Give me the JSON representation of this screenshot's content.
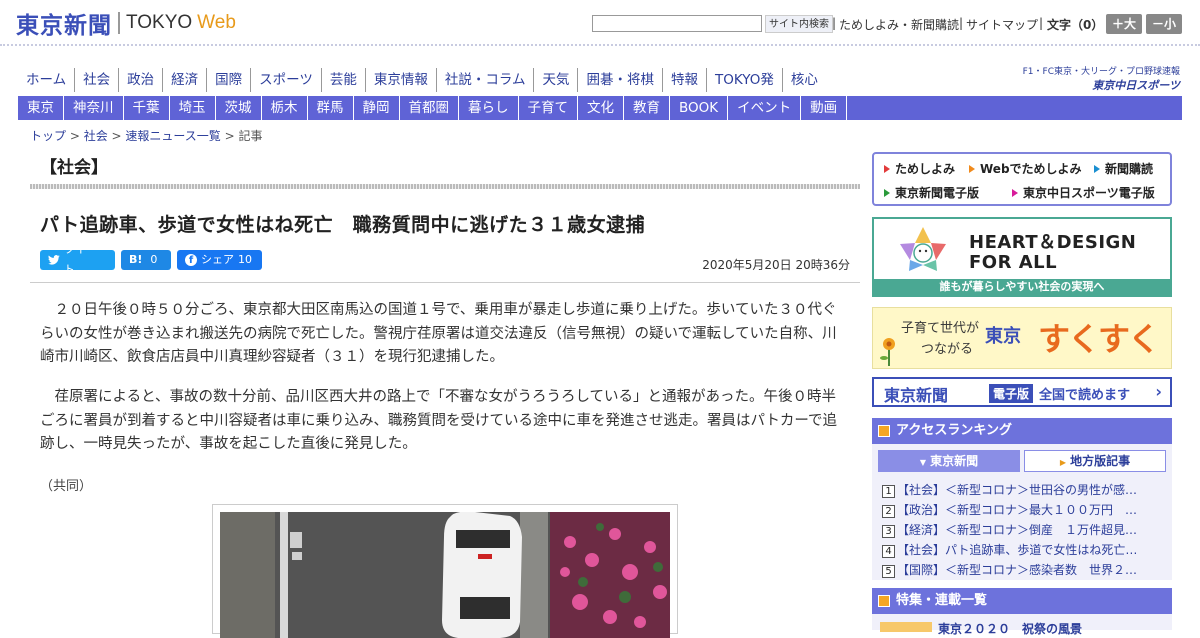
{
  "header": {
    "logo_jp": "東京新聞",
    "logo_en": "TOKYO",
    "logo_web": "Web",
    "search_placeholder": "",
    "search_button": "サイト内検索",
    "link_trial": "ためしよみ・新聞購読",
    "link_sitemap": "サイトマップ",
    "font_size_label": "文字（0）",
    "font_larger": "＋大",
    "font_smaller": "－小"
  },
  "main_nav": [
    "ホーム",
    "社会",
    "政治",
    "経済",
    "国際",
    "スポーツ",
    "芸能",
    "東京情報",
    "社説・コラム",
    "天気",
    "囲碁・将棋",
    "特報",
    "TOKYO発",
    "核心"
  ],
  "sponsor": {
    "line1": "F1・FC東京・大リーグ・プロ野球速報",
    "line2": "東京中日スポーツ"
  },
  "region_nav": [
    "東京",
    "神奈川",
    "千葉",
    "埼玉",
    "茨城",
    "栃木",
    "群馬",
    "静岡",
    "首都圏",
    "暮らし",
    "子育て",
    "文化",
    "教育",
    "BOOK",
    "イベント",
    "動画"
  ],
  "breadcrumb": {
    "top": "トップ",
    "sep": " > ",
    "social": "社会",
    "news": "速報ニュース一覧",
    "current": "記事"
  },
  "article": {
    "section": "【社会】",
    "headline": "パト追跡車、歩道で女性はね死亡　職務質問中に逃げた３１歳女逮捕",
    "tweet_label": "ツイート",
    "hatena_label": "B!",
    "hatena_count": "0",
    "fb_label": "シェア",
    "fb_count": "10",
    "date": "2020年5月20日 20時36分",
    "paragraphs": [
      "２０日午後０時５０分ごろ、東京都大田区南馬込の国道１号で、乗用車が暴走し歩道に乗り上げた。歩いていた３０代ぐらいの女性が巻き込まれ搬送先の病院で死亡した。警視庁荏原署は道交法違反（信号無視）の疑いで運転していた自称、川崎市川崎区、飲食店店員中川真理紗容疑者（３１）を現行犯逮捕した。",
      "荏原署によると、事故の数十分前、品川区西大井の路上で「不審な女がうろうろしている」と通報があった。午後０時半ごろに署員が到着すると中川容疑者は車に乗り込み、職務質問を受けている途中に車を発進させ逃走。署員はパトカーで追跡し、一時見失ったが、事故を起こした直後に発見した。"
    ],
    "credit": "（共同）"
  },
  "sidebar": {
    "links": [
      "ためしよみ",
      "Webでためしよみ",
      "新聞購読",
      "東京新聞電子版",
      "東京中日スポーツ電子版"
    ],
    "link_colors": [
      "#e23b3b",
      "#f08a1c",
      "#1a8fd1",
      "#2a9a3a",
      "#d81b9a"
    ],
    "heart_line1": "HEART＆DESIGN",
    "heart_line2": "FOR ALL",
    "heart_caption": "誰もが暮らしやすい社会の実現へ",
    "suku_line1": "子育て世代が",
    "suku_line2": "つながる",
    "suku_tokyo": "東京",
    "suku_brand": "すくすく",
    "edition_name": "東京新聞",
    "edition_badge": "電子版",
    "edition_text": "全国で読めます",
    "ranking_title": "アクセスランキング",
    "tab_tokyo": "東京新聞",
    "tab_local": "地方版記事",
    "ranking": [
      {
        "num": "1",
        "text": "【社会】＜新型コロナ＞世田谷の男性が感…"
      },
      {
        "num": "2",
        "text": "【政治】＜新型コロナ＞最大１００万円　…"
      },
      {
        "num": "3",
        "text": "【経済】＜新型コロナ＞倒産　１万件超見…"
      },
      {
        "num": "4",
        "text": "【社会】パト追跡車、歩道で女性はね死亡…"
      },
      {
        "num": "5",
        "text": "【国際】＜新型コロナ＞感染者数　世界２…"
      }
    ],
    "feature_title": "特集・連載一覧",
    "feature_item": "東京２０２０　祝祭の風景"
  }
}
